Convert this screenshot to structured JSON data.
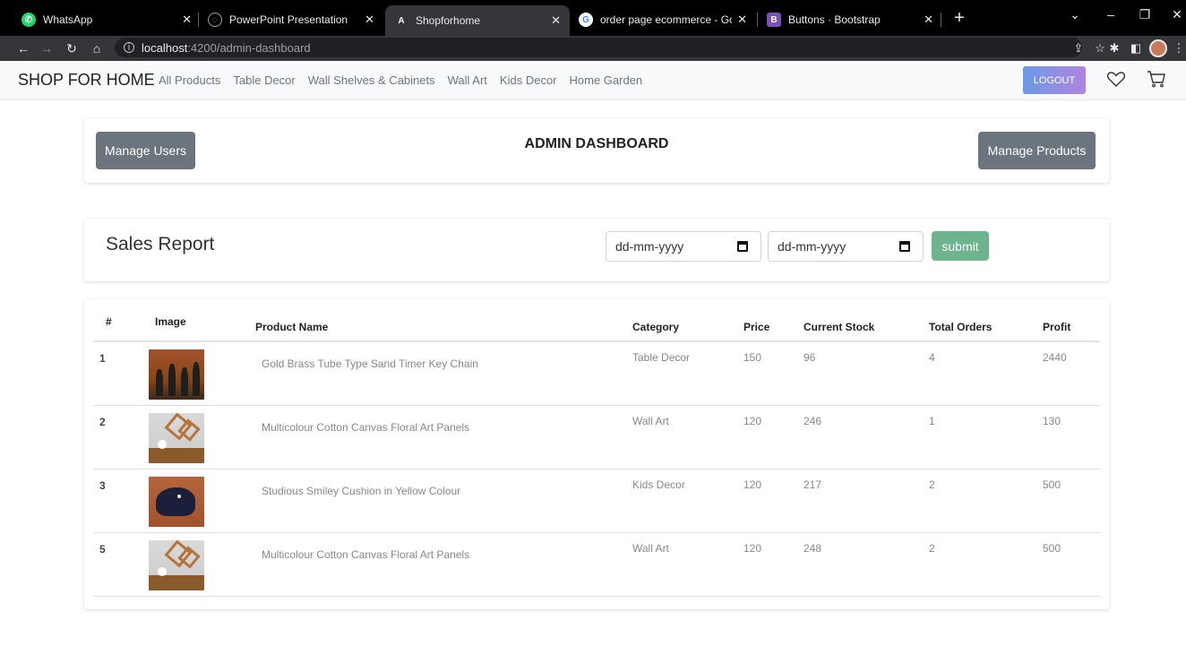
{
  "browser": {
    "tabs": [
      {
        "label": "WhatsApp",
        "icon": "whatsapp-icon",
        "color": "#25d366"
      },
      {
        "label": "PowerPoint Presentation",
        "icon": "globe-icon",
        "color": "#9aa0a6"
      },
      {
        "label": "Shopforhome",
        "icon": "angular-icon",
        "color": "#ffffff"
      },
      {
        "label": "order page ecommerce - Google",
        "icon": "google-icon",
        "color": "#4285f4"
      },
      {
        "label": "Buttons · Bootstrap",
        "icon": "bootstrap-icon",
        "color": "#7952b3"
      }
    ],
    "url_host": "localhost",
    "url_path": ":4200/admin-dashboard"
  },
  "navbar": {
    "brand": "SHOP FOR HOME",
    "links": [
      "All Products",
      "Table Decor",
      "Wall Shelves & Cabinets",
      "Wall Art",
      "Kids Decor",
      "Home Garden"
    ],
    "logout_label": "LOGOUT"
  },
  "header": {
    "manage_users_label": "Manage Users",
    "title": "ADMIN DASHBOARD",
    "manage_products_label": "Manage Products"
  },
  "sales": {
    "title": "Sales Report",
    "from_placeholder": "dd-mm-yyyy",
    "to_placeholder": "dd-mm-yyyy",
    "submit_label": "submit"
  },
  "table": {
    "columns": [
      "#",
      "Image",
      "Product Name",
      "Category",
      "Price",
      "Current Stock",
      "Total Orders",
      "Profit"
    ],
    "rows": [
      {
        "num": "1",
        "image": "musicians",
        "name": "Gold Brass Tube Type Sand Timer Key Chain",
        "category": "Table Decor",
        "price": "150",
        "stock": "96",
        "orders": "4",
        "profit": "2440"
      },
      {
        "num": "2",
        "image": "shelf",
        "name": "Multicolour Cotton Canvas Floral Art Panels",
        "category": "Wall Art",
        "price": "120",
        "stock": "246",
        "orders": "1",
        "profit": "130"
      },
      {
        "num": "3",
        "image": "dino",
        "name": "Studious Smiley Cushion in Yellow Colour",
        "category": "Kids Decor",
        "price": "120",
        "stock": "217",
        "orders": "2",
        "profit": "500"
      },
      {
        "num": "5",
        "image": "shelf",
        "name": "Multicolour Cotton Canvas Floral Art Panels",
        "category": "Wall Art",
        "price": "120",
        "stock": "248",
        "orders": "2",
        "profit": "500"
      }
    ]
  },
  "colors": {
    "secondary": "#6c757d",
    "success": "#6cb38e",
    "logout_gradient_start": "#6b9ae6",
    "logout_gradient_end": "#b084e0"
  }
}
